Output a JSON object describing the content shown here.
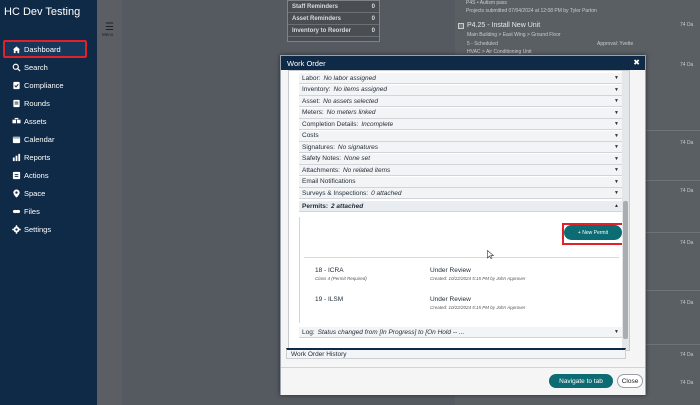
{
  "app": {
    "title": "HC Dev Testing"
  },
  "sidebar": {
    "items": [
      {
        "label": "Dashboard",
        "icon": "home-icon",
        "active": true
      },
      {
        "label": "Search",
        "icon": "search-icon"
      },
      {
        "label": "Compliance",
        "icon": "compliance-icon"
      },
      {
        "label": "Rounds",
        "icon": "rounds-icon"
      },
      {
        "label": "Assets",
        "icon": "assets-icon"
      },
      {
        "label": "Calendar",
        "icon": "calendar-icon"
      },
      {
        "label": "Reports",
        "icon": "reports-icon"
      },
      {
        "label": "Actions",
        "icon": "actions-icon"
      },
      {
        "label": "Space",
        "icon": "space-icon"
      },
      {
        "label": "Files",
        "icon": "files-icon"
      },
      {
        "label": "Settings",
        "icon": "gear-icon"
      }
    ]
  },
  "menu": {
    "label": "Menu"
  },
  "reminders": {
    "rows": [
      {
        "label": "Staff Reminders",
        "count": "0"
      },
      {
        "label": "Asset Reminders",
        "count": "0"
      },
      {
        "label": "Inventory to Reorder",
        "count": "0"
      }
    ]
  },
  "background_list": {
    "top_line": "P4S • Autism pass",
    "submitted_line": "Projects submitted 07/04/2024 at 12:08 PM by Tyler Parton",
    "item_title": "P4.25 - Install New Unit",
    "item_location": "Main Building > East Wing > Ground Floor",
    "item_status": "5 - Scheduled",
    "item_approval": "Approval: Yvette",
    "item_extra": "HVAC > Air Conditioning Unit",
    "day_badges": [
      "74 Da",
      "74 Da",
      "74 Da",
      "74 Da",
      "74 Da",
      "74 Da",
      "74 Da",
      "74 Da"
    ]
  },
  "modal": {
    "title": "Work Order",
    "sections": [
      {
        "label": "Labor:",
        "value": "No labor assigned"
      },
      {
        "label": "Inventory:",
        "value": "No items assigned"
      },
      {
        "label": "Asset:",
        "value": "No assets selected"
      },
      {
        "label": "Meters:",
        "value": "No meters linked"
      },
      {
        "label": "Completion Details:",
        "value": "Incomplete"
      },
      {
        "label": "Costs",
        "value": ""
      },
      {
        "label": "Signatures:",
        "value": "No signatures"
      },
      {
        "label": "Safety Notes:",
        "value": "None set"
      },
      {
        "label": "Attachments:",
        "value": "No related items"
      },
      {
        "label": "Email Notifications",
        "value": ""
      },
      {
        "label": "Surveys & Inspections:",
        "value": "0 attached"
      }
    ],
    "permits_header": {
      "label": "Permits:",
      "value": "2 attached"
    },
    "new_permit_label": "+ New Permit",
    "permits": [
      {
        "name": "18 - ICRA",
        "sub": "Class 4 (Permit Required)",
        "status": "Under Review",
        "created": "Created: 10/22/2024 5:15 PM by John Approver"
      },
      {
        "name": "19 - ILSM",
        "sub": "",
        "status": "Under Review",
        "created": "Created: 10/22/2024 5:15 PM by John Approver"
      }
    ],
    "log": {
      "label": "Log:",
      "value": "Status changed from [In Progress] to [On Hold -- ..."
    },
    "history_label": "Work Order History",
    "navigate_label": "Navigate to tab",
    "close_label": "Close"
  }
}
